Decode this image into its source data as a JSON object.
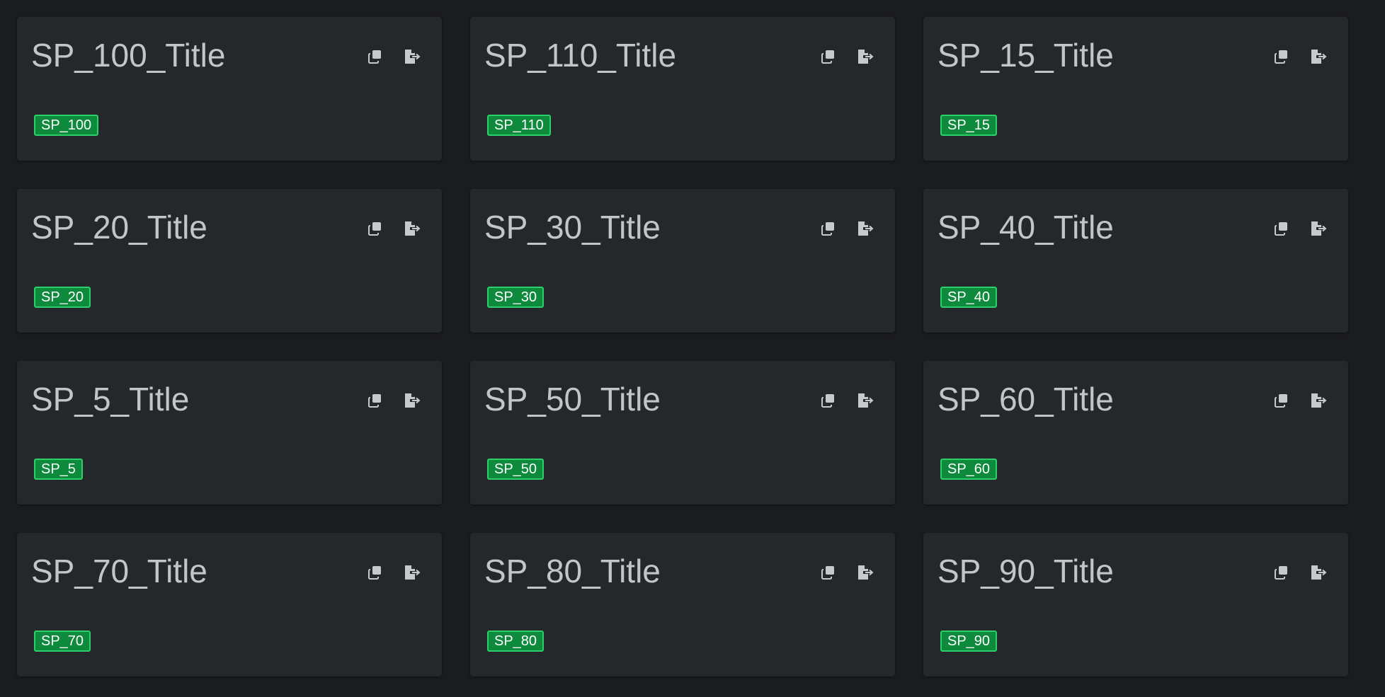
{
  "colors": {
    "page_background": "#1b1c1e",
    "card_background": "#25282a",
    "title_text": "#c4c5c6",
    "icon": "#c8c9ca",
    "badge_background": "#0e8a3c",
    "badge_border": "#2bd06a",
    "badge_text": "#ffffff"
  },
  "icons": {
    "copy": "copy-icon",
    "export": "file-export-icon"
  },
  "cards": [
    {
      "title": "SP_100_Title",
      "badge": "SP_100"
    },
    {
      "title": "SP_110_Title",
      "badge": "SP_110"
    },
    {
      "title": "SP_15_Title",
      "badge": "SP_15"
    },
    {
      "title": "SP_20_Title",
      "badge": "SP_20"
    },
    {
      "title": "SP_30_Title",
      "badge": "SP_30"
    },
    {
      "title": "SP_40_Title",
      "badge": "SP_40"
    },
    {
      "title": "SP_5_Title",
      "badge": "SP_5"
    },
    {
      "title": "SP_50_Title",
      "badge": "SP_50"
    },
    {
      "title": "SP_60_Title",
      "badge": "SP_60"
    },
    {
      "title": "SP_70_Title",
      "badge": "SP_70"
    },
    {
      "title": "SP_80_Title",
      "badge": "SP_80"
    },
    {
      "title": "SP_90_Title",
      "badge": "SP_90"
    }
  ]
}
